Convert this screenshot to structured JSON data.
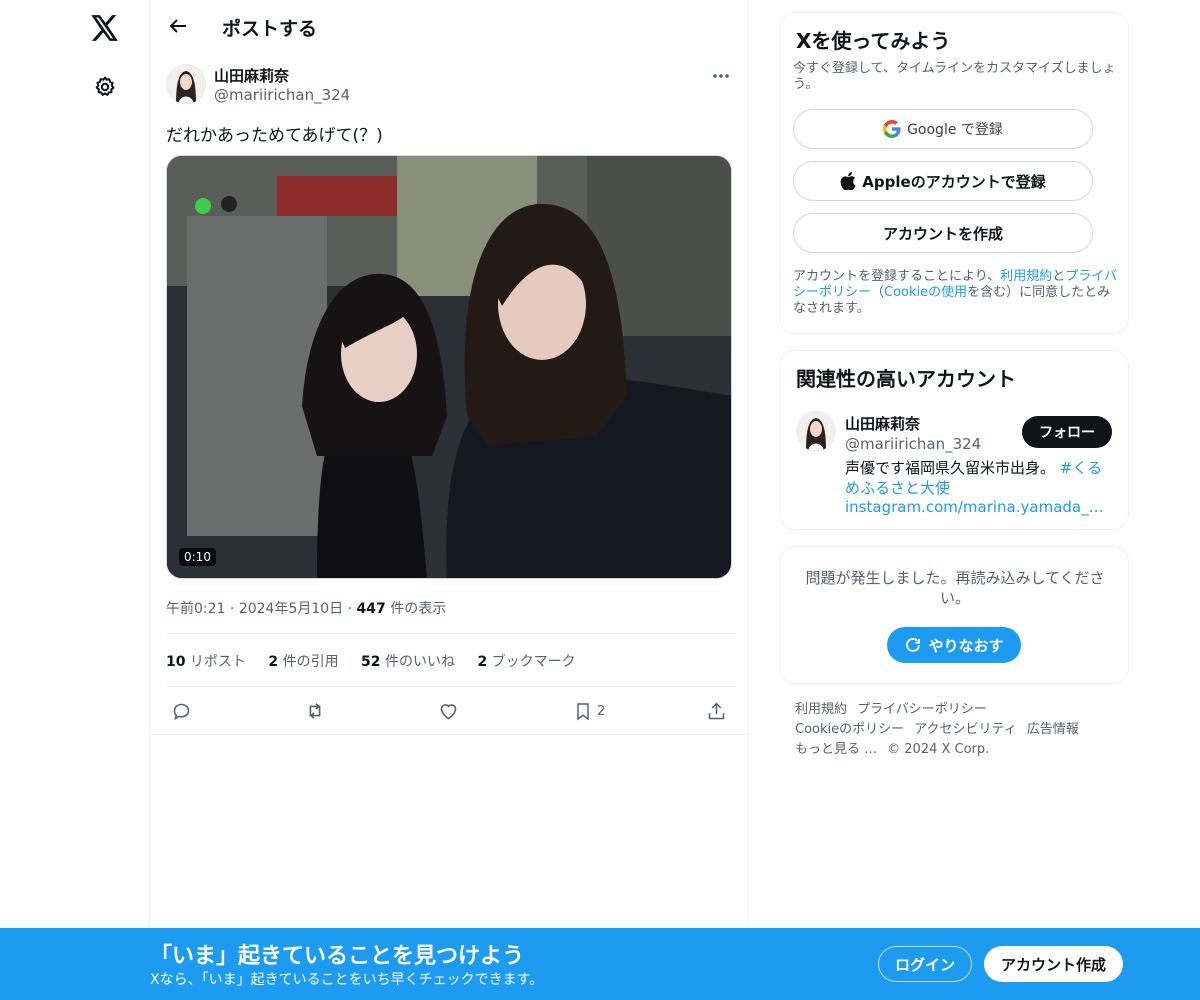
{
  "nav": {
    "logo_icon": "x-logo-icon",
    "settings_icon": "gear-icon"
  },
  "header": {
    "back_icon": "arrow-left-icon",
    "title": "ポストする"
  },
  "post": {
    "author_name": "山田麻莉奈",
    "author_handle": "@mariirichan_324",
    "text": "だれかあっためてあげて(？)",
    "video_duration": "0:10",
    "time": "午前0:21",
    "dot": "·",
    "date": "2024年5月10日",
    "view_count": "447",
    "view_label": " 件の表示",
    "stats": [
      {
        "num": "10",
        "label": " リポスト"
      },
      {
        "num": "2",
        "label": " 件の引用"
      },
      {
        "num": "52",
        "label": " 件のいいね"
      },
      {
        "num": "2",
        "label": " ブックマーク"
      }
    ],
    "bookmark_count": "2"
  },
  "signup_card": {
    "title": "Xを使ってみよう",
    "subtitle": "今すぐ登録して、タイムラインをカスタマイズしましょう。",
    "google_label": "Google で登録",
    "apple_label": "Appleのアカウントで登録",
    "create_label": "アカウントを作成",
    "legal_1": "アカウントを登録することにより、",
    "legal_terms": "利用規約",
    "legal_and": "と",
    "legal_privacy": "プライバシーポリシー",
    "legal_open": "（",
    "legal_cookie": "Cookieの使用",
    "legal_2": "を含む）に同意したとみなされます。"
  },
  "related": {
    "title": "関連性の高いアカウント",
    "name": "山田麻莉奈",
    "handle": "@mariirichan_324",
    "follow_label": "フォロー",
    "bio": "声優です󠄀󠄀福岡県久留米市出身。",
    "bio_hashtag": "#くるめふるさと大使",
    "link": "instagram.com/marina.yamada_…"
  },
  "error_card": {
    "message": "問題が発生しました。再読み込みしてください。",
    "retry_label": "やりなおす"
  },
  "footer": {
    "links": [
      "利用規約",
      "プライバシーポリシー",
      "Cookieのポリシー",
      "アクセシビリティ",
      "広告情報",
      "もっと見る …"
    ],
    "copyright": "© 2024 X Corp."
  },
  "banner": {
    "title": "「いま」起きていることを見つけよう",
    "subtitle": "Xなら、「いま」起きていることをいち早くチェックできます。",
    "login_label": "ログイン",
    "signup_label": "アカウント作成"
  },
  "colors": {
    "accent": "#1d9bf0",
    "text": "#0f1419",
    "secondary": "#536471"
  }
}
